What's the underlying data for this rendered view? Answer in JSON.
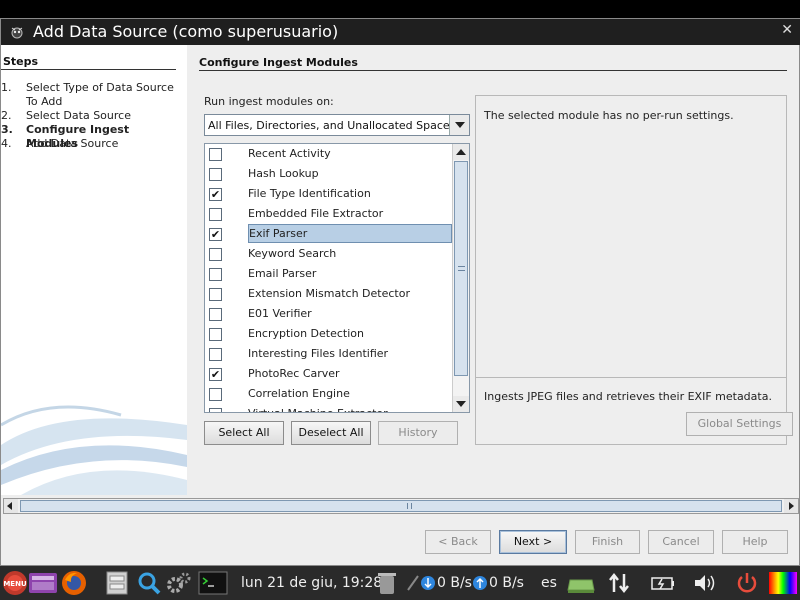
{
  "window": {
    "title": "Add Data Source (como superusuario)",
    "close_glyph": "✕"
  },
  "steps": {
    "header": "Steps",
    "items": [
      {
        "num": "1.",
        "label": "Select Type of Data Source To Add",
        "active": false
      },
      {
        "num": "2.",
        "label": "Select Data Source",
        "active": false
      },
      {
        "num": "3.",
        "label": "Configure Ingest Modules",
        "active": true
      },
      {
        "num": "4.",
        "label": "Add Data Source",
        "active": false
      }
    ]
  },
  "main": {
    "header": "Configure Ingest Modules",
    "run_label": "Run ingest modules on:",
    "run_value": "All Files, Directories, and Unallocated Space",
    "modules": [
      {
        "name": "Recent Activity",
        "checked": false,
        "selected": false
      },
      {
        "name": "Hash Lookup",
        "checked": false,
        "selected": false
      },
      {
        "name": "File Type Identification",
        "checked": true,
        "selected": false
      },
      {
        "name": "Embedded File Extractor",
        "checked": false,
        "selected": false
      },
      {
        "name": "Exif Parser",
        "checked": true,
        "selected": true
      },
      {
        "name": "Keyword Search",
        "checked": false,
        "selected": false
      },
      {
        "name": "Email Parser",
        "checked": false,
        "selected": false
      },
      {
        "name": "Extension Mismatch Detector",
        "checked": false,
        "selected": false
      },
      {
        "name": "E01 Verifier",
        "checked": false,
        "selected": false
      },
      {
        "name": "Encryption Detection",
        "checked": false,
        "selected": false
      },
      {
        "name": "Interesting Files Identifier",
        "checked": false,
        "selected": false
      },
      {
        "name": "PhotoRec Carver",
        "checked": true,
        "selected": false
      },
      {
        "name": "Correlation Engine",
        "checked": false,
        "selected": false
      },
      {
        "name": "Virtual Machine Extractor",
        "checked": false,
        "selected": false
      }
    ],
    "select_all": "Select All",
    "deselect_all": "Deselect All",
    "history": "History",
    "settings_msg": "The selected module has no per-run settings.",
    "module_desc": "Ingests JPEG files and retrieves their EXIF metadata.",
    "global_settings": "Global Settings"
  },
  "nav": {
    "back": "< Back",
    "next": "Next >",
    "finish": "Finish",
    "cancel": "Cancel",
    "help": "Help"
  },
  "taskbar": {
    "clock": "lun 21 de giu, 19:28",
    "down_speed": "0 B/s",
    "up_speed": "0 B/s",
    "lang": "es",
    "menu_label": "MENU"
  }
}
